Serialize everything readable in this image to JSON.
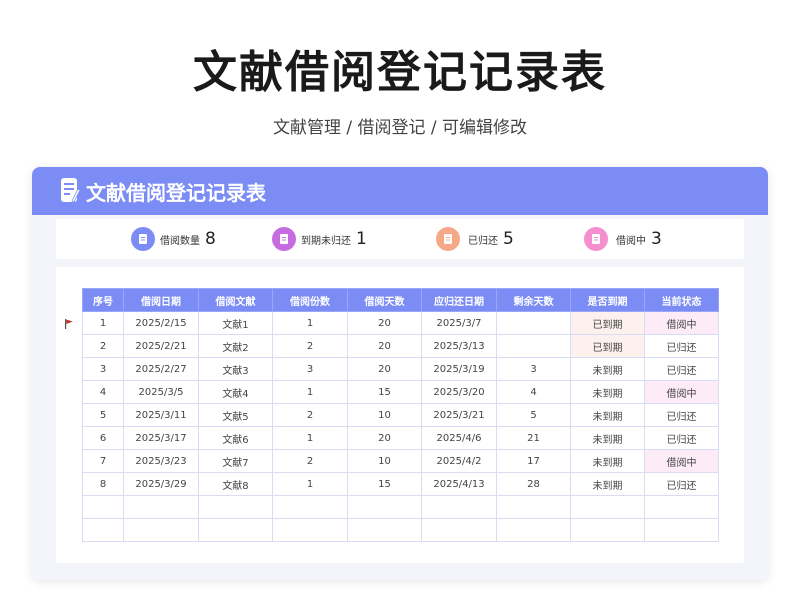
{
  "page": {
    "title": "文献借阅登记记录表",
    "subtitle": "文献管理 / 借阅登记 /  可编辑修改"
  },
  "card": {
    "title": "文献借阅登记记录表"
  },
  "stats": [
    {
      "label": "借阅数量",
      "value": "8",
      "color": "#7c8cf5"
    },
    {
      "label": "到期未归还",
      "value": "1",
      "color": "#c46ce0"
    },
    {
      "label": "已归还",
      "value": "5",
      "color": "#f5a988"
    },
    {
      "label": "借阅中",
      "value": "3",
      "color": "#f58fd0"
    }
  ],
  "table": {
    "headers": [
      "序号",
      "借阅日期",
      "借阅文献",
      "借阅份数",
      "借阅天数",
      "应归还日期",
      "剩余天数",
      "是否到期",
      "当前状态"
    ],
    "rows": [
      [
        "1",
        "2025/2/15",
        "文献1",
        "1",
        "20",
        "2025/3/7",
        "",
        "已到期",
        "借阅中"
      ],
      [
        "2",
        "2025/2/21",
        "文献2",
        "2",
        "20",
        "2025/3/13",
        "",
        "已到期",
        "已归还"
      ],
      [
        "3",
        "2025/2/27",
        "文献3",
        "3",
        "20",
        "2025/3/19",
        "3",
        "未到期",
        "已归还"
      ],
      [
        "4",
        "2025/3/5",
        "文献4",
        "1",
        "15",
        "2025/3/20",
        "4",
        "未到期",
        "借阅中"
      ],
      [
        "5",
        "2025/3/11",
        "文献5",
        "2",
        "10",
        "2025/3/21",
        "5",
        "未到期",
        "已归还"
      ],
      [
        "6",
        "2025/3/17",
        "文献6",
        "1",
        "20",
        "2025/4/6",
        "21",
        "未到期",
        "已归还"
      ],
      [
        "7",
        "2025/3/23",
        "文献7",
        "2",
        "10",
        "2025/4/2",
        "17",
        "未到期",
        "借阅中"
      ],
      [
        "8",
        "2025/3/29",
        "文献8",
        "1",
        "15",
        "2025/4/13",
        "28",
        "未到期",
        "已归还"
      ],
      [
        "",
        "",
        "",
        "",
        "",
        "",
        "",
        "",
        ""
      ],
      [
        "",
        "",
        "",
        "",
        "",
        "",
        "",
        "",
        ""
      ]
    ]
  },
  "colors": {
    "accent": "#7c8cf5",
    "overdue_bg": "#fdf1ee",
    "borrowing_bg": "#fdecf7",
    "flag": "#c0392b"
  },
  "icons": {
    "header": "document-edit-icon",
    "stat": "document-icon",
    "row_marker": "flag-icon"
  }
}
